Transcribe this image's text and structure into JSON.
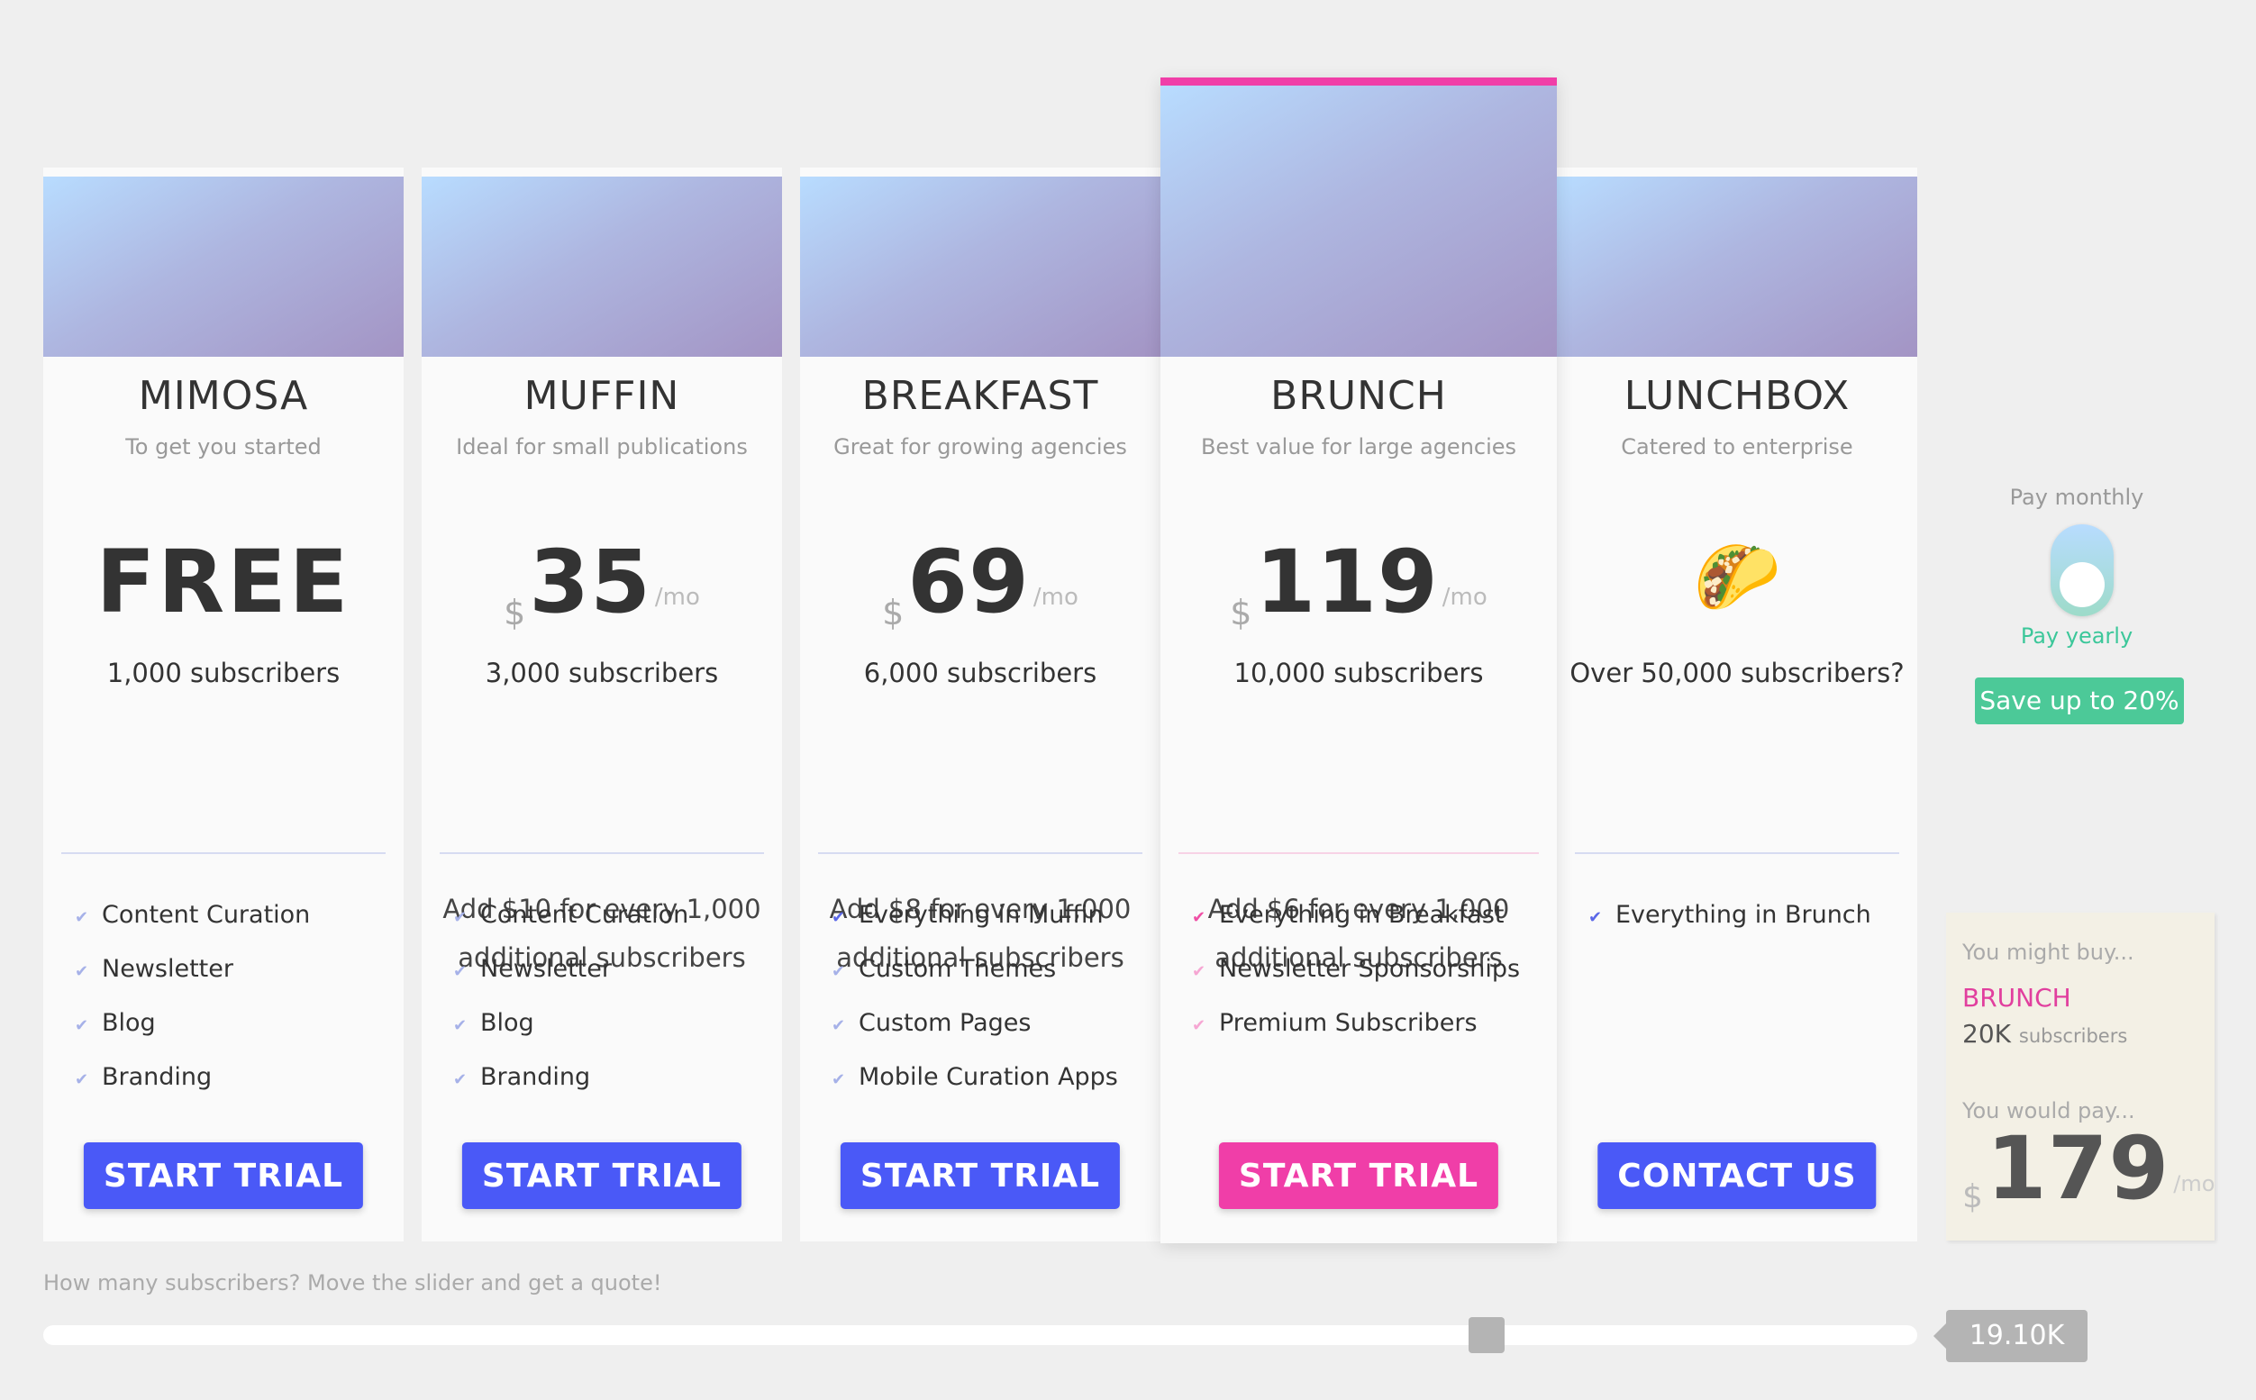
{
  "plans": [
    {
      "name": "MIMOSA",
      "tagline": "To get you started",
      "price_text": "FREE",
      "subscribers": "1,000 subscribers",
      "features": [
        "Content Curation",
        "Newsletter",
        "Blog",
        "Branding"
      ],
      "cta": "START TRIAL"
    },
    {
      "name": "MUFFIN",
      "tagline": "Ideal for small publications",
      "currency": "$",
      "price": "35",
      "period": "/mo",
      "subscribers": "3,000 subscribers",
      "extra_line1": "Add $10 for every 1,000",
      "extra_line2": "additional subscribers",
      "features": [
        "Content Curation",
        "Newsletter",
        "Blog",
        "Branding"
      ],
      "cta": "START TRIAL"
    },
    {
      "name": "BREAKFAST",
      "tagline": "Great for growing agencies",
      "currency": "$",
      "price": "69",
      "period": "/mo",
      "subscribers": "6,000 subscribers",
      "extra_line1": "Add $8 for every 1,000",
      "extra_line2": "additional subscribers",
      "features": [
        "Everything in Muffin",
        "Custom Themes",
        "Custom Pages",
        "Mobile Curation Apps"
      ],
      "cta": "START TRIAL"
    },
    {
      "name": "BRUNCH",
      "tagline": "Best value for large agencies",
      "currency": "$",
      "price": "119",
      "period": "/mo",
      "subscribers": "10,000 subscribers",
      "extra_line1": "Add $6 for every 1,000",
      "extra_line2": "additional subscribers",
      "features": [
        "Everything in Breakfast",
        "Newsletter Sponsorships",
        "Premium Subscribers"
      ],
      "cta": "START TRIAL"
    },
    {
      "name": "LUNCHBOX",
      "tagline": "Catered to enterprise",
      "price_icon": "taco-icon",
      "subscribers": "Over 50,000 subscribers?",
      "features": [
        "Everything in Brunch"
      ],
      "cta": "CONTACT US"
    }
  ],
  "billing": {
    "monthly_label": "Pay monthly",
    "yearly_label": "Pay yearly",
    "save_badge": "Save up to 20%",
    "selected": "yearly"
  },
  "quote": {
    "might_buy_label": "You might buy...",
    "plan": "BRUNCH",
    "subscribers_value": "20K",
    "subscribers_unit": "subscribers",
    "would_pay_label": "You would pay...",
    "currency": "$",
    "price": "179",
    "period": "/mo"
  },
  "slider": {
    "label": "How many subscribers? Move the slider and get a quote!",
    "value_text": "19.10K",
    "position_fraction": 0.77
  },
  "colors": {
    "primary_button": "#4a59f7",
    "featured_accent": "#f03ea8",
    "yearly_green": "#4cc998",
    "page_background": "#efefef"
  }
}
